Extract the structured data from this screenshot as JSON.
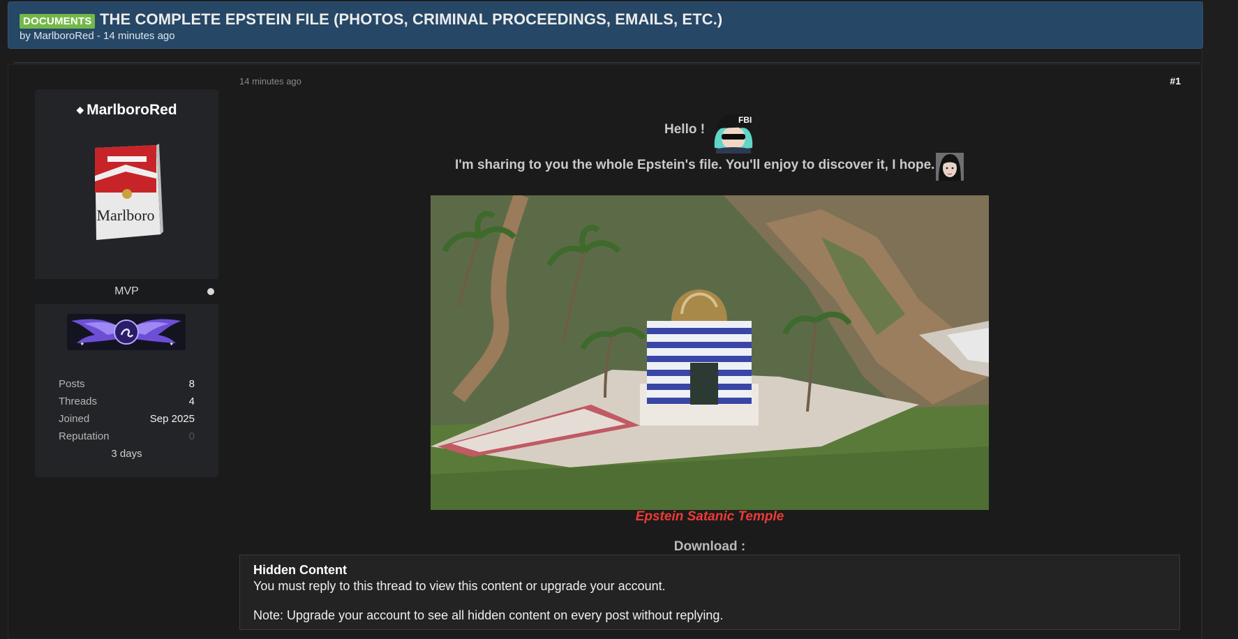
{
  "thread": {
    "prefix": "DOCUMENTS",
    "title": "THE COMPLETE EPSTEIN FILE (PHOTOS, CRIMINAL PROCEEDINGS, EMAILS, ETC.)",
    "meta": "by MarlboroRed - 14 minutes ago"
  },
  "user": {
    "name": "MarlboroRed",
    "rank": "MVP",
    "stats": [
      {
        "key": "Posts",
        "value": "8"
      },
      {
        "key": "Threads",
        "value": "4"
      },
      {
        "key": "Joined",
        "value": "Sep 2025"
      },
      {
        "key": "Reputation",
        "value": "0"
      }
    ],
    "extra": "3 days"
  },
  "post": {
    "time": "14 minutes ago",
    "number": "#1",
    "greeting": "Hello !",
    "intro": "I'm sharing to you the whole Epstein's file. You'll enjoy to discover it, I hope.",
    "caption": "Epstein Satanic Temple",
    "download_label": "Download :"
  },
  "hidden": {
    "title": "Hidden Content",
    "message": "You must reply to this thread to view this content or upgrade your account.",
    "note": "Note: Upgrade your account to see all hidden content on every post without replying."
  },
  "colors": {
    "header_bg": "#264766",
    "prefix_bg": "#74b84a",
    "caption": "#ee3b36"
  }
}
